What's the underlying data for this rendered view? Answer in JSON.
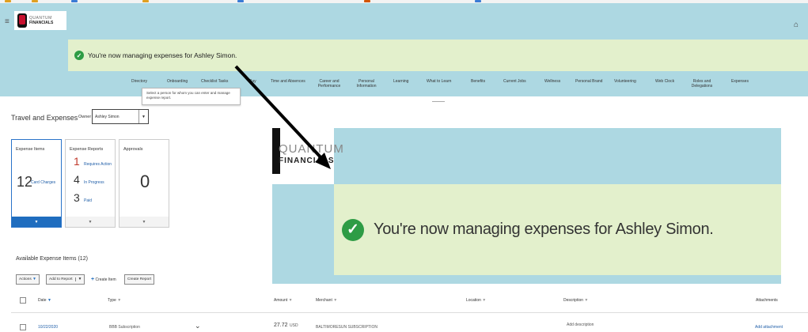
{
  "logo": {
    "line1": "QUANTUM",
    "line2": "FINANCIALS"
  },
  "banner": {
    "message": "You're now managing expenses for Ashley Simon."
  },
  "nav": {
    "items": [
      {
        "label": "Directory"
      },
      {
        "label": "Onboarding"
      },
      {
        "label": "Checklist Tasks"
      },
      {
        "label": "Pay"
      },
      {
        "label": "Time and Absences"
      },
      {
        "label": "Career and Performance"
      },
      {
        "label": "Personal Information"
      },
      {
        "label": "Learning"
      },
      {
        "label": "What to Learn"
      },
      {
        "label": "Benefits"
      },
      {
        "label": "Current Jobs"
      },
      {
        "label": "Wellness"
      },
      {
        "label": "Personal Brand"
      },
      {
        "label": "Volunteering"
      },
      {
        "label": "Web Clock"
      },
      {
        "label": "Roles and Delegations"
      },
      {
        "label": "Expenses"
      }
    ]
  },
  "tooltip": {
    "text": "Select a person for whom you can enter and manage expense report."
  },
  "page": {
    "title": "Travel and Expenses",
    "owner_label": "Owner",
    "owner_value": "Ashley Simon"
  },
  "tiles": {
    "expense_items": {
      "title": "Expense Items",
      "count": "12",
      "link": "Card Charges"
    },
    "expense_reports": {
      "title": "Expense Reports",
      "stats": [
        {
          "count": "1",
          "label": "Requires Action",
          "color": "#c0392b"
        },
        {
          "count": "4",
          "label": "In Progress",
          "color": "#333333"
        },
        {
          "count": "3",
          "label": "Paid",
          "color": "#333333"
        }
      ]
    },
    "approvals": {
      "title": "Approvals",
      "count": "0"
    }
  },
  "available": {
    "title": "Available Expense Items (12)"
  },
  "toolbar": {
    "actions": "Actions",
    "add_to_report": "Add to Report",
    "create_item": "Create Item",
    "create_report": "Create Report"
  },
  "table": {
    "headers": {
      "date": "Date",
      "type": "Type",
      "amount": "Amount",
      "merchant": "Merchant",
      "location": "Location",
      "description": "Description",
      "attachments": "Attachments"
    },
    "row": {
      "date": "10/22/2020",
      "type": "BBB Subscription",
      "amount": "27.72",
      "currency": "USD",
      "merchant": "BALTIMORESUN SUBSCRIPTION",
      "description": "Add description",
      "attachment": "Add attachment"
    }
  },
  "colors": {
    "header_bg": "#add8e2",
    "banner_bg": "#e3f0cc",
    "success": "#2e9c45",
    "link": "#1f5ea8",
    "selected_tile": "#1f6dbf"
  }
}
